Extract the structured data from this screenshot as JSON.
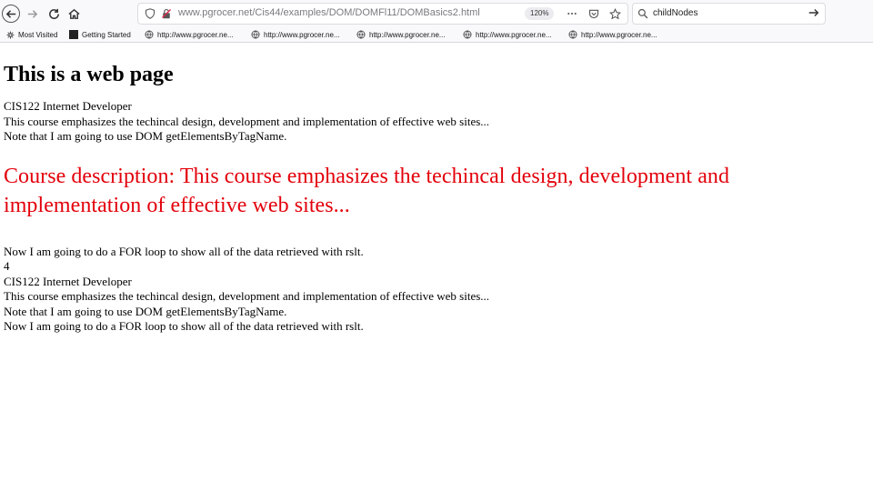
{
  "browser": {
    "url": "www.pgrocer.net/Cis44/examples/DOM/DOMFl11/DOMBasics2.html",
    "zoom": "120%",
    "search_query": "childNodes",
    "bookmarks": [
      {
        "label": "Most Visited",
        "icon": "gear-icon"
      },
      {
        "label": "Getting Started",
        "icon": "logo-icon"
      },
      {
        "label": "http://www.pgrocer.ne...",
        "icon": "globe-icon"
      },
      {
        "label": "http://www.pgrocer.ne...",
        "icon": "globe-icon"
      },
      {
        "label": "http://www.pgrocer.ne...",
        "icon": "globe-icon"
      },
      {
        "label": "http://www.pgrocer.ne...",
        "icon": "globe-icon"
      },
      {
        "label": "http://www.pgrocer.ne...",
        "icon": "globe-icon"
      }
    ]
  },
  "page": {
    "heading": "This is a web page",
    "lines_top": [
      "CIS122 Internet Developer",
      "This course emphasizes the techincal design, development and implementation of effective web sites...",
      "Note that I am going to use DOM getElementsByTagName."
    ],
    "description": "Course description: This course emphasizes the techincal design, development and implementation of effective web sites...",
    "description_color": "#e3000b",
    "lines_bottom": [
      "Now I am going to do a FOR loop to show all of the data retrieved with rslt.",
      "4",
      "CIS122 Internet Developer",
      "This course emphasizes the techincal design, development and implementation of effective web sites...",
      "Note that I am going to use DOM getElementsByTagName.",
      "Now I am going to do a FOR loop to show all of the data retrieved with rslt."
    ]
  }
}
